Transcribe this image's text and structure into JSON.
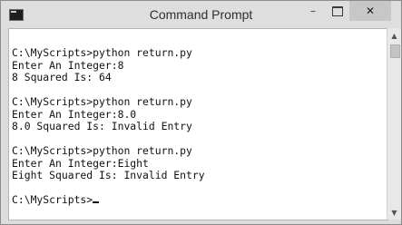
{
  "window": {
    "title": "Command Prompt",
    "icon": "cmd-icon",
    "controls": {
      "minimize": "–",
      "maximize": "maximize-icon",
      "close": "✕"
    }
  },
  "console": {
    "lines": [
      "",
      "C:\\MyScripts>python return.py",
      "Enter An Integer:8",
      "8 Squared Is: 64",
      "",
      "C:\\MyScripts>python return.py",
      "Enter An Integer:8.0",
      "8.0 Squared Is: Invalid Entry",
      "",
      "C:\\MyScripts>python return.py",
      "Enter An Integer:Eight",
      "Eight Squared Is: Invalid Entry",
      "",
      "C:\\MyScripts>"
    ]
  },
  "scrollbar": {
    "up": "▲",
    "down": "▼"
  }
}
